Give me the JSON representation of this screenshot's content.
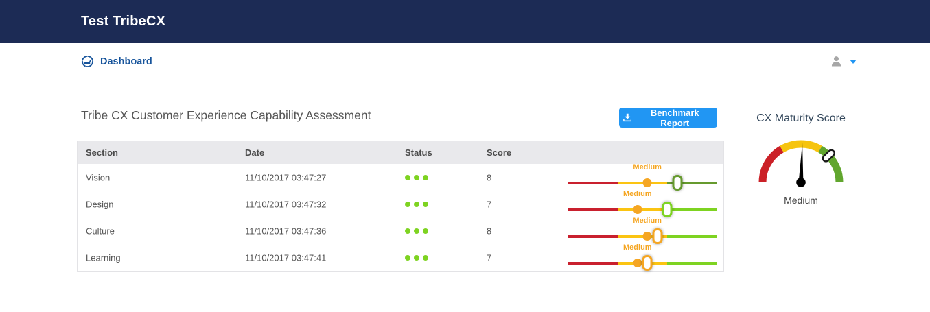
{
  "colors": {
    "header_bg": "#1c2b55",
    "link_blue": "#17549b",
    "accent_blue": "#2196f3",
    "table_header_bg": "#e9e9ec",
    "red": "#c9202e",
    "yellow": "#fbc412",
    "amber": "#f5a623",
    "green_bright": "#7ed321",
    "green_dark": "#669a2e",
    "gauge_red": "#cb2027",
    "gauge_yellow": "#f6c40f",
    "gauge_green": "#61a62e"
  },
  "header": {
    "title": "Test TribeCX"
  },
  "nav": {
    "dashboard_label": "Dashboard"
  },
  "main": {
    "title": "Tribe CX Customer Experience Capability Assessment",
    "benchmark_button_label": "Benchmark Report"
  },
  "table": {
    "headers": {
      "section": "Section",
      "date": "Date",
      "status": "Status",
      "score": "Score"
    },
    "status_dot_count": 3,
    "rows": [
      {
        "section": "Vision",
        "date": "11/10/2017 03:47:27",
        "score": "8",
        "slider": {
          "label": "Medium",
          "dot_pct": 53.3,
          "handle_pct": 73.3,
          "handle_color": "#669a2e",
          "green_color": "#669a2e"
        }
      },
      {
        "section": "Design",
        "date": "11/10/2017 03:47:32",
        "score": "7",
        "slider": {
          "label": "Medium",
          "dot_pct": 46.7,
          "handle_pct": 66.7,
          "handle_color": "#7ed321",
          "green_color": "#7ed321"
        }
      },
      {
        "section": "Culture",
        "date": "11/10/2017 03:47:36",
        "score": "8",
        "slider": {
          "label": "Medium",
          "dot_pct": 53.3,
          "handle_pct": 60.0,
          "handle_color": "#f5a623",
          "green_color": "#7ed321"
        }
      },
      {
        "section": "Learning",
        "date": "11/10/2017 03:47:41",
        "score": "7",
        "slider": {
          "label": "Medium",
          "dot_pct": 46.7,
          "handle_pct": 53.3,
          "handle_color": "#f5a623",
          "green_color": "#7ed321"
        }
      }
    ]
  },
  "gauge": {
    "title": "CX Maturity Score",
    "value": "Medium",
    "needle_deg_from_vertical": 2,
    "marker_deg_from_vertical": 46
  }
}
